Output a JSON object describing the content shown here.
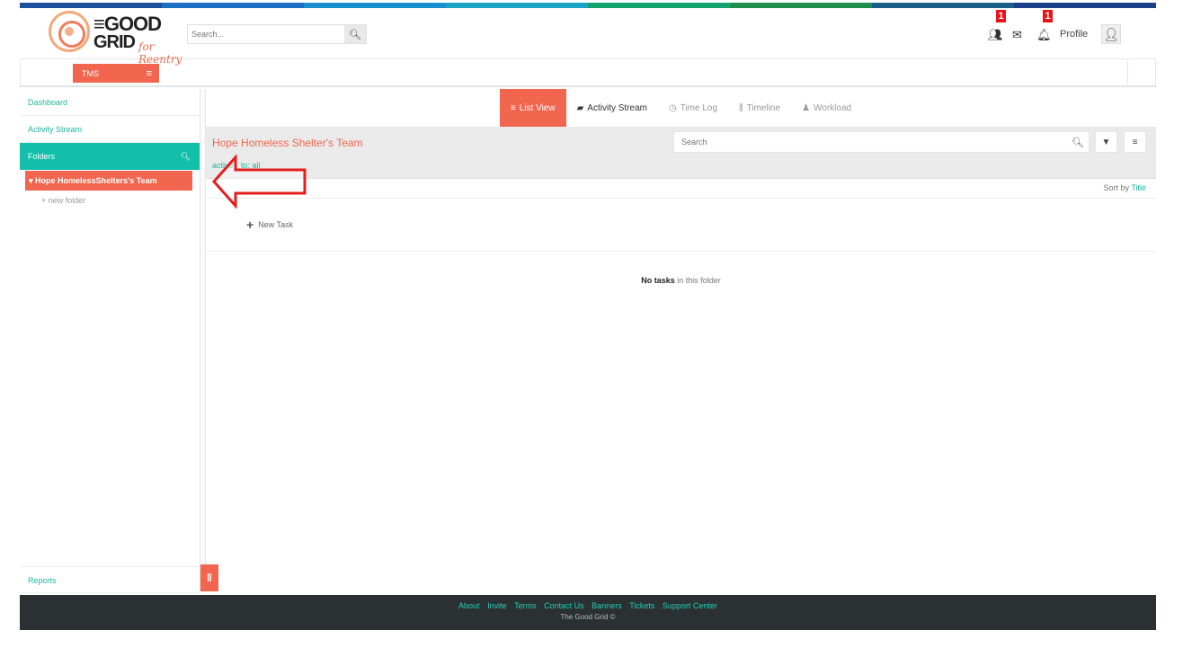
{
  "brand": {
    "line1": "≡GOOD",
    "line2": "GRID",
    "tagline": "for Reentry",
    "colors": {
      "accent": "#f2654e",
      "teal": "#13bfaa",
      "link": "#1fb5a1",
      "badge": "#e8141a"
    }
  },
  "header": {
    "search_placeholder": "Search...",
    "search_icon": "search-icon",
    "icons": [
      {
        "name": "users-icon",
        "badge": "1"
      },
      {
        "name": "envelope-icon",
        "badge": ""
      },
      {
        "name": "bell-icon",
        "badge": "1"
      }
    ],
    "profile_label": "Profile"
  },
  "module": {
    "label": "TMS"
  },
  "sidebar": {
    "items": [
      {
        "label": "Dashboard"
      },
      {
        "label": "Activity Stream"
      }
    ],
    "folders_label": "Folders",
    "folder_item": "Hope HomelessShelters's Team",
    "new_folder": "+ new folder",
    "reports": "Reports"
  },
  "tabs": [
    {
      "label": "List View",
      "icon": "≡",
      "state": "active"
    },
    {
      "label": "Activity Stream",
      "icon": "▰",
      "state": "dark"
    },
    {
      "label": "Time Log",
      "icon": "◷",
      "state": "muted"
    },
    {
      "label": "Timeline",
      "icon": "⫼",
      "state": "muted"
    },
    {
      "label": "Workload",
      "icon": "♟",
      "state": "muted"
    }
  ],
  "team": {
    "title": "Hope Homeless Shelter's Team",
    "filter_active": "active",
    "filter_all": "to: all",
    "search_placeholder": "Search"
  },
  "list": {
    "sort_prefix": "Sort by",
    "sort_value": "Title",
    "new_task": "New Task",
    "empty_bold": "No tasks",
    "empty_rest": " in this folder"
  },
  "footer": {
    "links": [
      "About",
      "Invite",
      "Terms",
      "Contact Us",
      "Banners",
      "Tickets",
      "Support Center"
    ],
    "copyright": "The Good Grid ©"
  }
}
